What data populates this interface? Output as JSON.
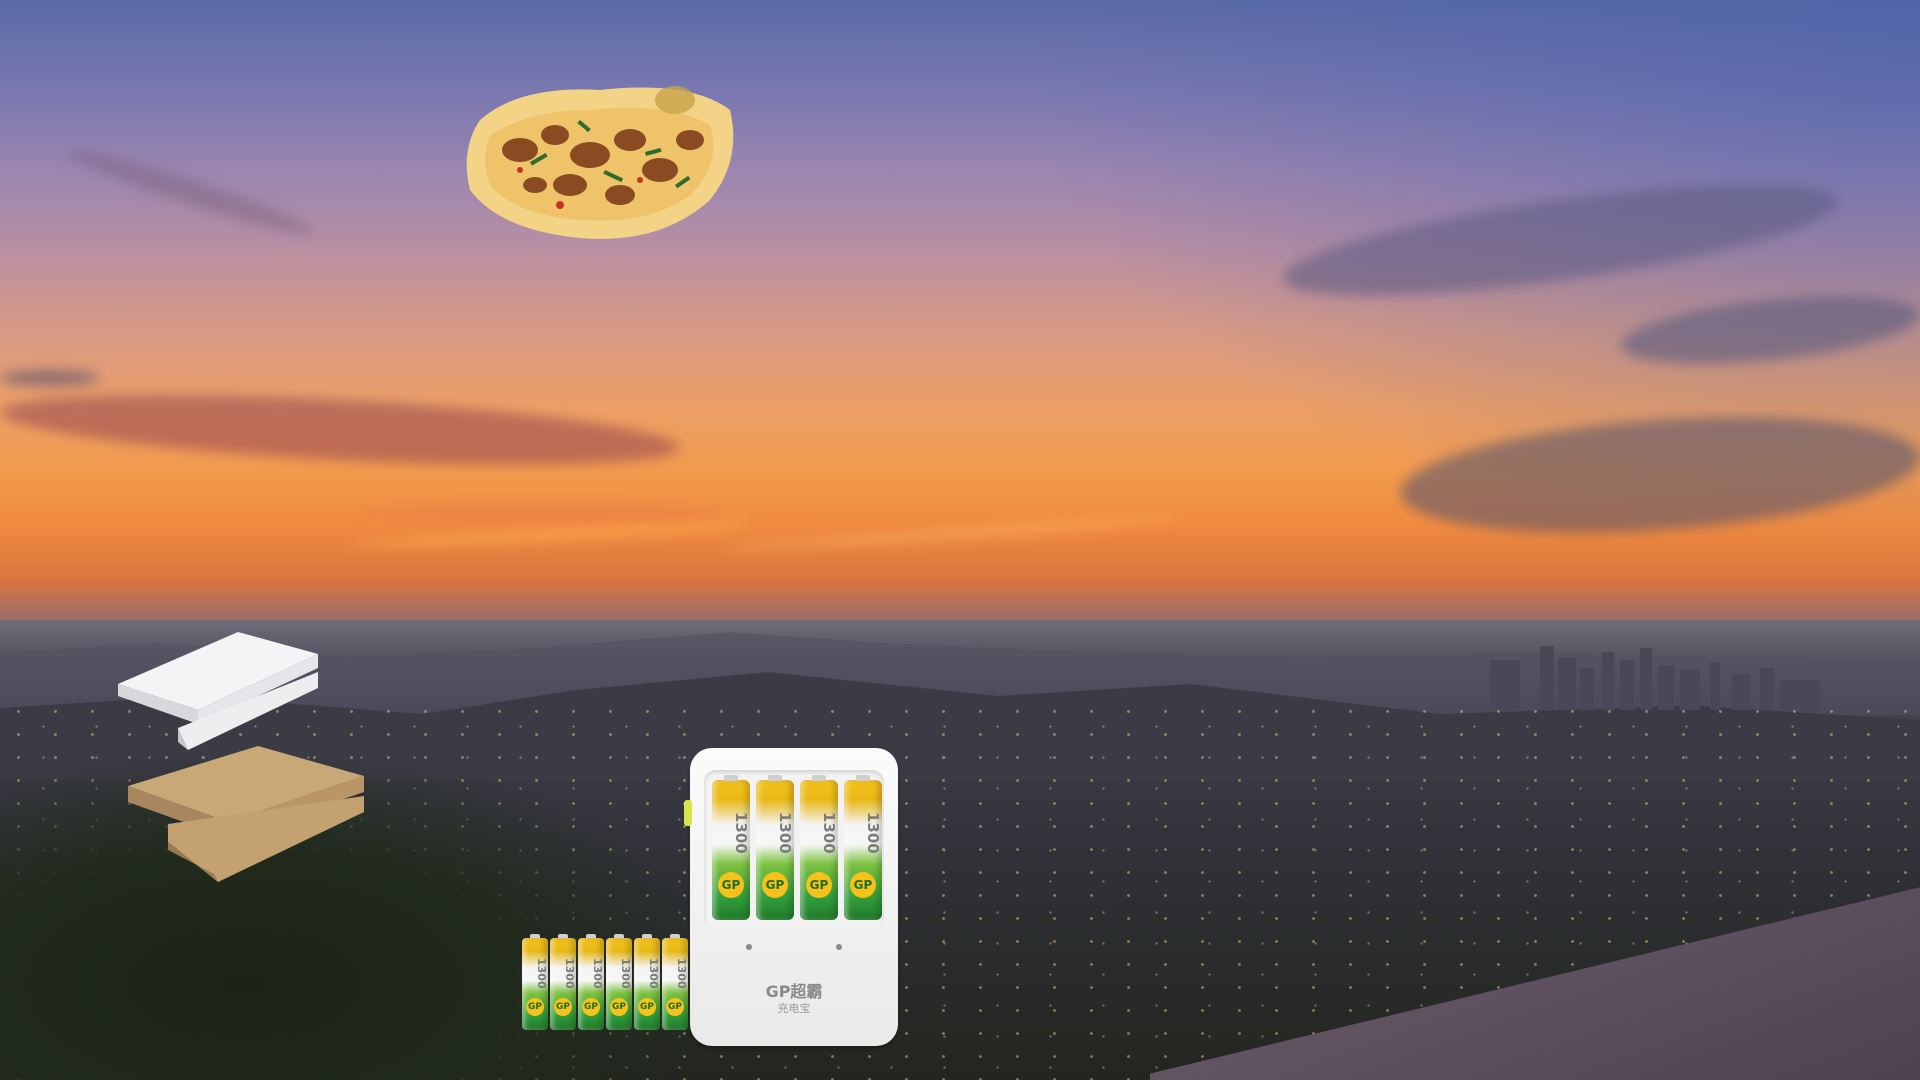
{
  "scene": {
    "description_tag": "",
    "charger": {
      "brand_label": "GP超霸",
      "sub_label": "充电宝",
      "battery_labels": [
        "1300",
        "1300",
        "1300",
        "1300"
      ],
      "battery_logo": "GP"
    },
    "loose_batteries": {
      "labels": [
        "1300",
        "1300",
        "1300",
        "1300",
        "1300",
        "1300"
      ],
      "battery_logo": "GP"
    },
    "colors": {
      "battery_yellow": "#f5c21b",
      "battery_green": "#2f9b3a",
      "sky_top": "#5a6aa6",
      "sky_horizon": "#f0893f"
    }
  }
}
